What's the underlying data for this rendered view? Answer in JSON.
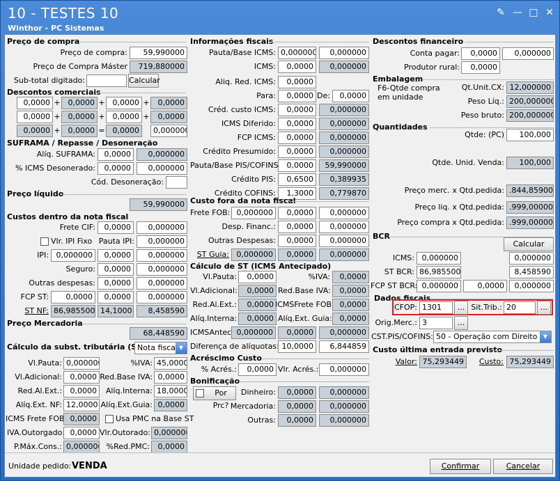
{
  "window": {
    "title": "10 - TESTES 10",
    "subtitle": "Winthor - PC Sistemas"
  },
  "preco_compra": {
    "title": "Preço de compra",
    "preco_label": "Preço de compra:",
    "preco": "59,990000",
    "master_label": "Preço de Compra Máster",
    "master": "719,880000",
    "subtotal_label": "Sub-total digitado:",
    "subtotal": "",
    "calcular": "Calcular"
  },
  "descontos_comerciais": {
    "title": "Descontos comerciais",
    "rows": [
      [
        "0,0000",
        "0,0000",
        "0,0000",
        "0,0000"
      ],
      [
        "0,0000",
        "0,0000",
        "0,0000",
        "0,0000"
      ],
      [
        "0,0000",
        "0,0000",
        "0,0000",
        "0,000000"
      ]
    ]
  },
  "suframa": {
    "title": "SUFRAMA / Repasse / Desoneração",
    "aliq_label": "Alíq. SUFRAMA:",
    "aliq": "0,0000",
    "aliq2": "0,000000",
    "icms_label": "% ICMS Desonerado:",
    "icms": "0,0000",
    "icms2": "0,000000",
    "cod_label": "Cód. Desoneração:",
    "cod": ""
  },
  "preco_liquido": {
    "title": "Preço líquido",
    "value": "59,990000"
  },
  "custos_nota": {
    "title": "Custos dentro da nota fiscal",
    "frete_label": "Frete CIF:",
    "frete": "0,0000",
    "frete2": "0,000000",
    "vlr_ipi_label": "Vlr. IPI Fixo",
    "pauta_ipi_label": "Pauta IPI:",
    "pauta_ipi": "0,000000",
    "ipi_label": "IPI:",
    "ipi1": "0,000000",
    "ipi2": "0,0000",
    "ipi3": "0,000000",
    "seguro_label": "Seguro:",
    "seguro": "0,0000",
    "seguro2": "0,000000",
    "outras_label": "Outras despesas:",
    "outras": "0,0000",
    "outras2": "0,000000",
    "fcp_label": "FCP ST:",
    "fcp1": "0,0000",
    "fcp2": "0,0000",
    "fcp3": "0,000000",
    "stnf_label": "ST NF:",
    "stnf1": "86,985500",
    "stnf2": "14,1000",
    "stnf3": "8,458590"
  },
  "preco_mercadoria": {
    "title": "Preço Mercadoria",
    "value": "68,448590"
  },
  "calc_st": {
    "title": "Cálculo da subst. tributária (ST)",
    "select": "Nota fiscal",
    "vlpauta_label": "Vl.Pauta:",
    "vlpauta": "0,000000",
    "iva_label": "%IVA:",
    "iva": "45,0000",
    "vladic_label": "Vl.Adicional:",
    "vladic": "0,0000",
    "redbaseiva_label": "Red.Base IVA:",
    "redbaseiva": "0,0000",
    "redalext_label": "Red.Al.Ext.:",
    "redalext": "0,0000",
    "aliqint_label": "Alíq.Interna:",
    "aliqint": "18,0000",
    "aliqextnf_label": "Alíq.Ext. NF:",
    "aliqextnf": "12,0000",
    "aliqextguia_label": "Alíq.Ext.Guia:",
    "aliqextguia": "0,0000",
    "icmsfrete_label": "ICMS Frete FOB:",
    "icmsfrete": "0,0000",
    "usapmc_label": "Usa PMC na Base ST",
    "ivaout_label": "IVA.Outorgado:",
    "ivaout": "0,0000",
    "vlrout_label": "Vlr.Outorado:",
    "vlrout": "0,000000",
    "pmax_label": "P.Máx.Cons.:",
    "pmax": "0,000000",
    "redpmc_label": "%Red.PMC:",
    "redpmc": "0,0000"
  },
  "info_fiscais": {
    "title": "Informações fiscais",
    "rows": [
      {
        "label": "Pauta/Base ICMS:",
        "v1": "0,000000",
        "v2": "0,000000"
      },
      {
        "label": "ICMS:",
        "v1": "0,0000",
        "v2": "0,000000"
      },
      {
        "label": "Aliq. Red. ICMS:",
        "v1": "0,0000",
        "v2": ""
      },
      {
        "label": "Para:",
        "v1": "0,0000",
        "v2": "0,0000",
        "mid": "De:"
      },
      {
        "label": "Créd. custo ICMS:",
        "v1": "0,0000",
        "v2": "0,000000"
      },
      {
        "label": "ICMS Diferido:",
        "v1": "0,0000",
        "v2": "0,000000"
      },
      {
        "label": "FCP ICMS:",
        "v1": "0,0000",
        "v2": "0,000000"
      },
      {
        "label": "Crédito Presumido:",
        "v1": "0,0000",
        "v2": "0,000000"
      },
      {
        "label": "Pauta/Base PIS/COFINS:",
        "v1": "0,0000",
        "v2": "59,990000"
      },
      {
        "label": "Crédito PIS:",
        "v1": "0,6500",
        "v2": "0,389935"
      },
      {
        "label": "Crédito COFINS:",
        "v1": "1,3000",
        "v2": "0,779870"
      }
    ]
  },
  "custo_fora": {
    "title": "Custo fora da nota fiscal",
    "frete_label": "Frete FOB:",
    "frete1": "0,000000",
    "frete2": "0,0000",
    "frete3": "0,000000",
    "desp_label": "Desp. Financ.:",
    "desp1": "0,0000",
    "desp2": "0,000000",
    "outras_label": "Outras Despesas:",
    "outras1": "0,0000",
    "outras2": "0,000000",
    "stguia_label": "ST Guia:",
    "stguia1": "0,000000",
    "stguia2": "0,0000",
    "stguia3": "0,000000"
  },
  "calc_st_ant": {
    "title": "Cálculo de ST (ICMS Antecipado)",
    "vlpauta_label": "Vl.Pauta:",
    "vlpauta": "0,0000",
    "iva_label": "%IVA:",
    "iva": "0,0000",
    "vladic_label": "Vl.Adicional:",
    "vladic": "0,0000",
    "redbaseiva_label": "Red.Base IVA:",
    "redbaseiva": "0,0000",
    "redal_label": "Red.Al.Ext.:",
    "redal": "0,0000",
    "icmsfrete_label": "ICMSFrete FOB:",
    "icmsfrete": "0,0000",
    "aliqint_label": "Alíq.Interna:",
    "aliqint": "0,0000",
    "aliqext_label": "Alíq.Ext. Guia:",
    "aliqext": "0,0000",
    "icmsantec_label": "ICMSAntec:",
    "icmsantec1": "0,000000",
    "icmsantec2": "0,0000",
    "icmsantec3": "0,000000",
    "dif_label": "Diferença de alíquotas:",
    "dif1": "10,0000",
    "dif2": "6,844859"
  },
  "acrescimo": {
    "title": "Acréscimo Custo",
    "perc_label": "% Acrés.:",
    "perc": "0,0000",
    "vlr_label": "Vlr. Acrés.:",
    "vlr": "0,000000"
  },
  "bonificacao": {
    "title": "Bonificação",
    "porprc_label": "Por Prc?",
    "dinheiro_label": "Dinheiro:",
    "dinheiro1": "0,0000",
    "dinheiro2": "0,000000",
    "merc_label": "Mercadoria:",
    "merc1": "0,0000",
    "merc2": "0,000000",
    "outras_label": "Outras:",
    "outras1": "0,0000",
    "outras2": "0,000000"
  },
  "descontos_fin": {
    "title": "Descontos financeiro",
    "conta_label": "Conta pagar:",
    "conta1": "0,0000",
    "conta2": "0,000000",
    "rural_label": "Produtor rural:",
    "rural": "0,0000"
  },
  "embalagem": {
    "title": "Embalagem",
    "f6_label": "F6-Qtde compra em unidade",
    "qtunit_label": "Qt.Unit.CX:",
    "qtunit": "12,000000",
    "pesoliq_label": "Peso Líq.:",
    "pesoliq": "200,000000",
    "pesobruto_label": "Peso bruto:",
    "pesobruto": "200,000000"
  },
  "quantidades": {
    "title": "Quantidades",
    "qtde_label": "Qtde: (PC)",
    "qtde": "100,000",
    "qtdeunid_label": "Qtde. Unid. Venda:",
    "qtdeunid": "100,000",
    "precomerc_label": "Preço merc. x Qtd.pedida:",
    ".precomerc": "",
    "precomerc": ".844,859000",
    "precoliq_label": "Preço liq. x Qtd.pedida:",
    "precoliq": ".999,000000",
    "precocompra_label": "Preço compra x Qtd.pedida:",
    "precocompra": ".999,000000"
  },
  "bcr": {
    "title": "BCR",
    "calcular": "Calcular",
    "icms_label": "ICMS:",
    "icms1": "0,000000",
    "icms2": "0,000000",
    "st_label": "ST BCR:",
    "st1": "86,985500",
    "st2": "8,458590",
    "fcp_label": "FCP ST BCR:",
    "fcp1": "0,000000",
    "fcp2": "0,0000",
    "fcp3": "0,000000"
  },
  "dados_fiscais": {
    "title": "Dados fiscais",
    "cfop_label": "CFOP:",
    "cfop": "1301",
    "sittrib_label": "Sit.Trib.:",
    "sittrib": "20",
    "origmerc_label": "Orig.Merc.:",
    "origmerc": "3",
    "cst_label": "CST.PIS/COFINS:",
    "cst": "50 - Operação com Direito a Cr",
    "ellipsis": "..."
  },
  "custo_ultima": {
    "title": "Custo última entrada previsto",
    "valor_label": "Valor:",
    "valor": "75,293449",
    "custo_label": "Custo:",
    "custo": "75,293449"
  },
  "footer": {
    "unidade_label": "Unidade pedido:",
    "unidade": "VENDA",
    "confirmar": "Confirmar",
    "cancelar": "Cancelar"
  },
  "colors": {
    "title_bar": "#2a6cc0",
    "readonly_field": "#c8d0d8",
    "highlight": "#e02020"
  }
}
